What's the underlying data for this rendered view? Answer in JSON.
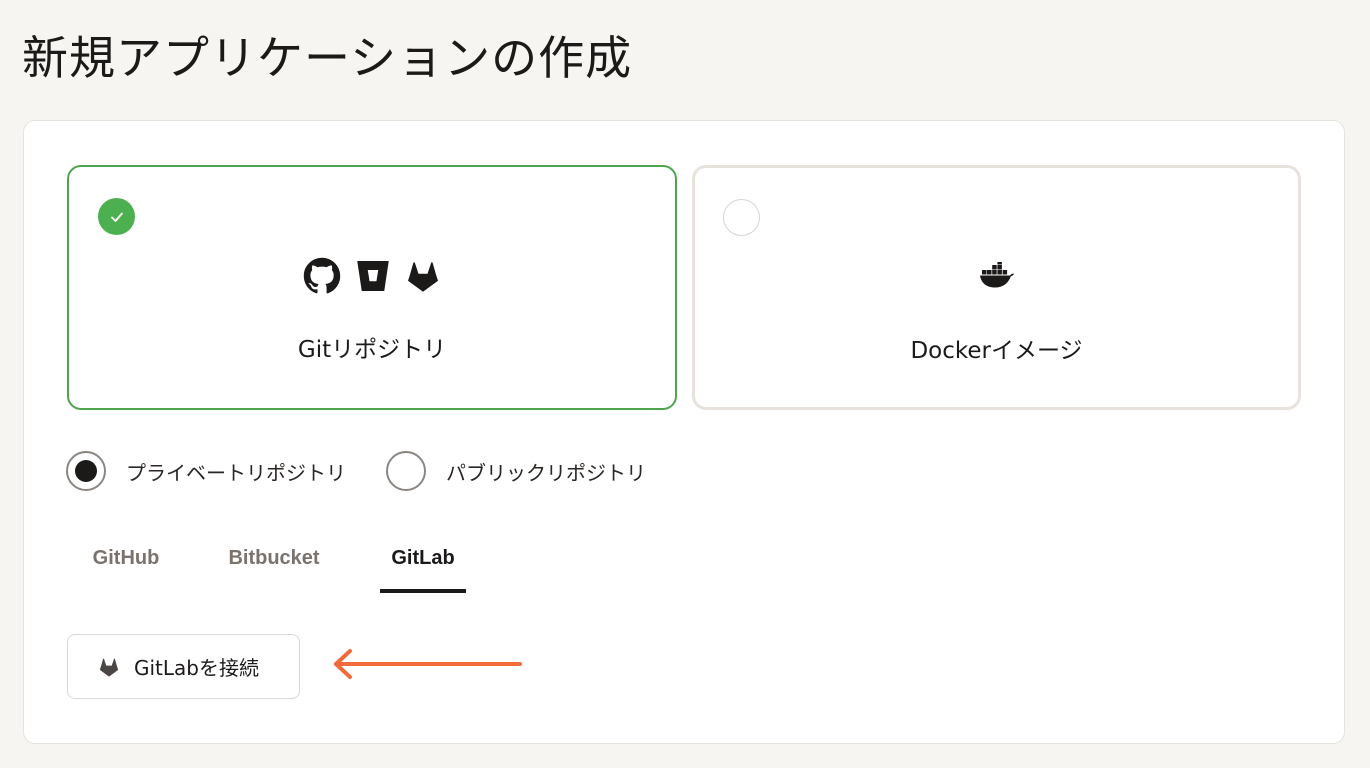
{
  "page": {
    "title": "新規アプリケーションの作成"
  },
  "source_cards": [
    {
      "label": "Gitリポジトリ",
      "selected": true,
      "icons": [
        "github-icon",
        "bitbucket-icon",
        "gitlab-icon"
      ]
    },
    {
      "label": "Dockerイメージ",
      "selected": false,
      "icons": [
        "docker-icon"
      ]
    }
  ],
  "visibility": {
    "options": [
      {
        "label": "プライベートリポジトリ",
        "selected": true
      },
      {
        "label": "パブリックリポジトリ",
        "selected": false
      }
    ]
  },
  "providers": {
    "tabs": [
      {
        "label": "GitHub",
        "active": false
      },
      {
        "label": "Bitbucket",
        "active": false
      },
      {
        "label": "GitLab",
        "active": true
      }
    ]
  },
  "connect": {
    "label": "GitLabを接続",
    "icon": "gitlab-icon"
  },
  "colors": {
    "selected_border": "#4fa54f",
    "check_fill": "#4caf50",
    "annotation_arrow": "#f26b3a"
  },
  "annotation": {
    "icon": "left-arrow-icon"
  }
}
